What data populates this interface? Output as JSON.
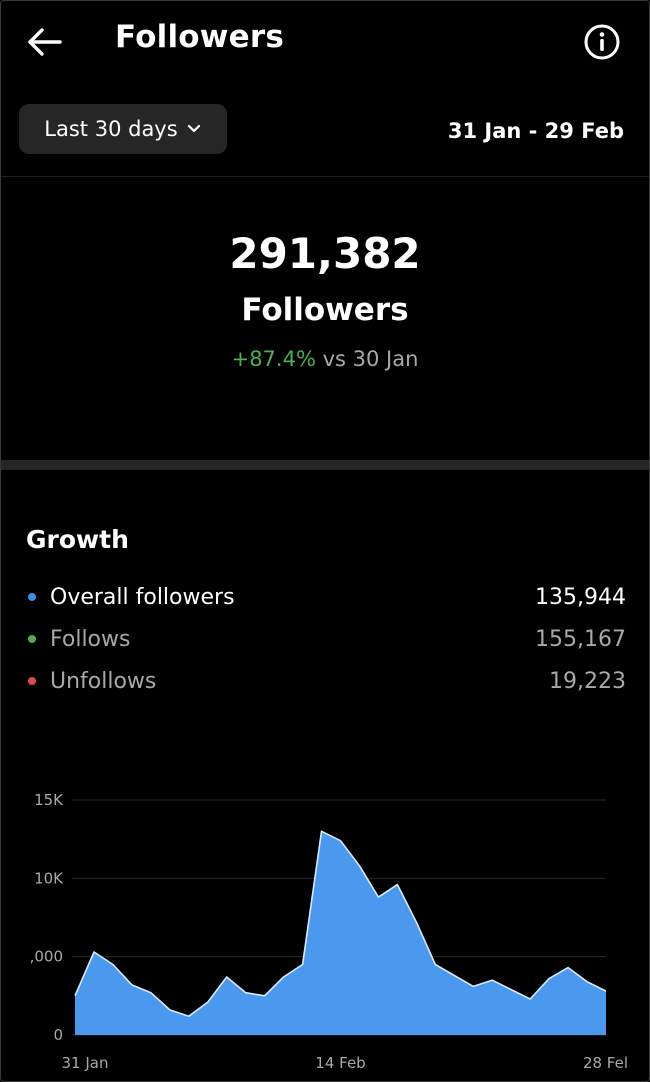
{
  "header": {
    "title": "Followers",
    "back_icon": "arrow-left-icon",
    "info_icon": "info-circle-icon"
  },
  "filter": {
    "range_label": "Last 30 days",
    "date_range": "31 Jan - 29 Feb"
  },
  "summary": {
    "total": "291,382",
    "label": "Followers",
    "change_pct": "+87.4%",
    "change_suffix": "vs 30 Jan"
  },
  "growth": {
    "title": "Growth",
    "metrics": [
      {
        "label": "Overall followers",
        "value": "135,944",
        "color": "#3d8ef0"
      },
      {
        "label": "Follows",
        "value": "155,167",
        "color": "#4caf50"
      },
      {
        "label": "Unfollows",
        "value": "19,223",
        "color": "#e0474c"
      }
    ]
  },
  "colors": {
    "background": "#000000",
    "accent_blue": "#4a99ef",
    "positive_green": "#4caf50"
  },
  "chart_data": {
    "type": "area",
    "xlabel": "",
    "ylabel": "",
    "y_tick_labels": [
      "0",
      ",000",
      "10K",
      "15K"
    ],
    "y_tick_values": [
      0,
      5000,
      10000,
      15000
    ],
    "x_tick_labels": [
      "31 Jan",
      "14 Feb",
      "28 Fel"
    ],
    "x_tick_index": [
      0,
      14,
      28
    ],
    "ylim": [
      0,
      15000
    ],
    "grid": true,
    "series": [
      {
        "color": "#4a99ef",
        "values": [
          2500,
          5300,
          4500,
          3200,
          2700,
          1600,
          1200,
          2100,
          3700,
          2700,
          2500,
          3700,
          4500,
          13000,
          12400,
          10800,
          8800,
          9600,
          7200,
          4500,
          3800,
          3100,
          3500,
          2900,
          2300,
          3600,
          4300,
          3400,
          2800
        ]
      }
    ]
  }
}
